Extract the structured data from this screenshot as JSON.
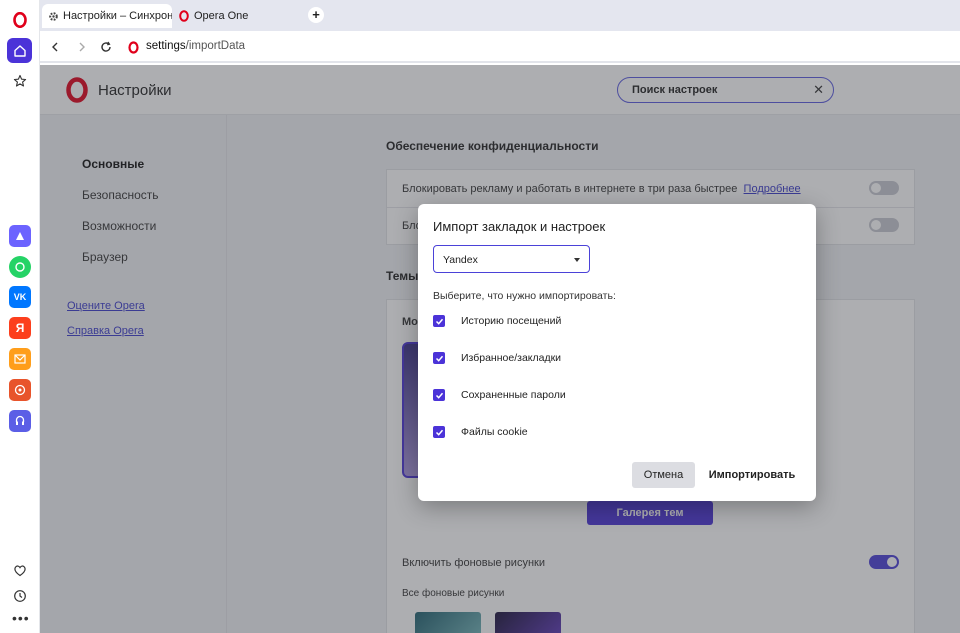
{
  "tabs": [
    {
      "label": "Настройки – Синхрониза",
      "icon": "gear-icon",
      "active": true
    },
    {
      "label": "Opera One",
      "icon": "opera-logo-icon",
      "active": false
    }
  ],
  "address": {
    "host": "settings",
    "path": "/importData"
  },
  "settings": {
    "title": "Настройки",
    "search_placeholder": "Поиск настроек",
    "nav": [
      "Основные",
      "Безопасность",
      "Возможности",
      "Браузер"
    ],
    "links": [
      "Оцените Opera",
      "Справка Opera"
    ],
    "privacy_title": "Обеспечение конфиденциальности",
    "adblock_text": "Блокировать рекламу и работать в интернете в три раза быстрее",
    "adblock_link": "Подробнее",
    "row2_text": "Бло",
    "themes_title": "Темы",
    "themes_sub": "Мо",
    "gallery_button": "Галерея тем",
    "bg_toggle_label": "Включить фоновые рисунки",
    "bg_all_label": "Все фоновые рисунки"
  },
  "dialog": {
    "title": "Импорт закладок и настроек",
    "source_value": "Yandex",
    "choose_label": "Выберите, что нужно импортировать:",
    "items": [
      {
        "label": "Историю посещений",
        "checked": true
      },
      {
        "label": "Избранное/закладки",
        "checked": true
      },
      {
        "label": "Сохраненные пароли",
        "checked": true
      },
      {
        "label": "Файлы cookie",
        "checked": true
      }
    ],
    "cancel_label": "Отмена",
    "import_label": "Импортировать"
  },
  "colors": {
    "accent": "#4b33d8",
    "overlay": "#3c3e46"
  }
}
